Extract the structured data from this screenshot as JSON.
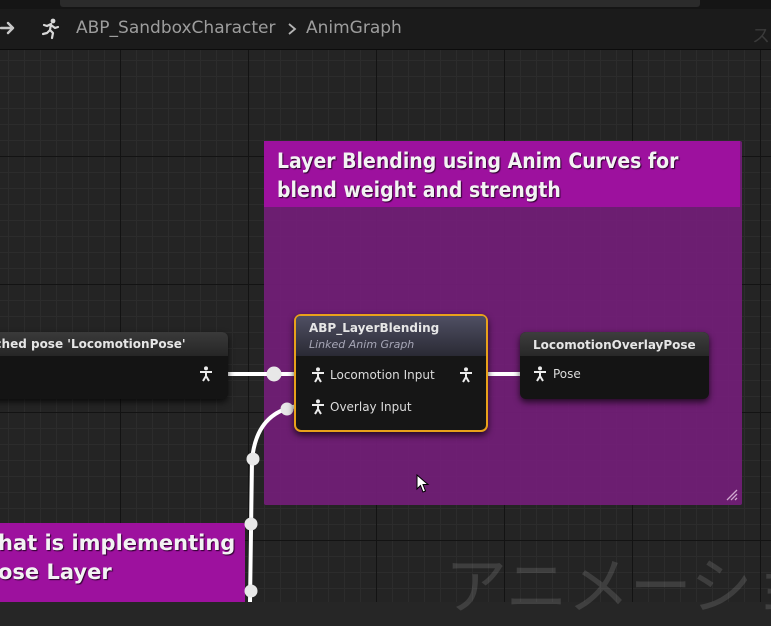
{
  "breadcrumb": {
    "asset": "ABP_SandboxCharacter",
    "separator": ">",
    "graph": "AnimGraph",
    "watermark_right": "ス"
  },
  "icons": {
    "nav": "arrow-right-icon",
    "anim_blueprint": "running-figure-icon",
    "pose_pin": "pose-mannequin-icon",
    "resize": "resize-grip-icon",
    "cursor": "mouse-pointer-icon"
  },
  "comments": {
    "main_title": "Layer Blending using Anim Curves for blend weight and strength",
    "bottom_line1": "hat is implementing",
    "bottom_line2": "ose Layer"
  },
  "nodes": {
    "cached_pose": {
      "title": "Use cached pose 'LocomotionPose'"
    },
    "layer_blending": {
      "title": "ABP_LayerBlending",
      "subtitle": "Linked Anim Graph",
      "pins": [
        "Locomotion Input",
        "Overlay Input"
      ]
    },
    "overlay_pose": {
      "title": "LocomotionOverlayPose",
      "pin": "Pose"
    }
  },
  "graph_watermark": "アニメーショ",
  "colors": {
    "comment_header": "#9d119e",
    "comment_body": "#731e78",
    "selected_outline": "#e8a11b",
    "wire": "#ffffff",
    "graph_bg": "#242424"
  }
}
